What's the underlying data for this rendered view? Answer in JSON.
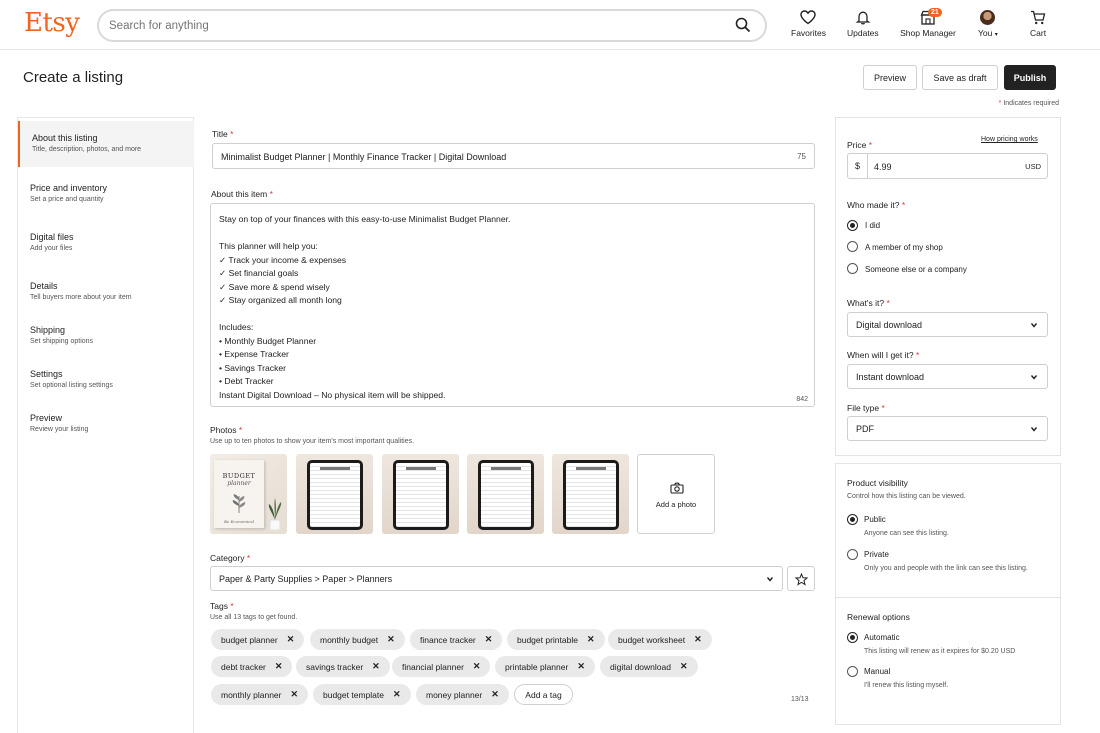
{
  "header": {
    "logo": "Etsy",
    "search_placeholder": "Search for anything",
    "nav": {
      "favorites": "Favorites",
      "updates": "Updates",
      "shop_manager": "Shop Manager",
      "shop_manager_badge": "21",
      "you": "You",
      "cart": "Cart"
    }
  },
  "page": {
    "title": "Create a listing",
    "preview_label": "Preview",
    "save_draft_label": "Save as draft",
    "publish_label": "Publish",
    "required_note": "Indicates required",
    "required_mark": "*"
  },
  "sidebar": {
    "items": [
      {
        "title": "About this listing",
        "desc": "Title, description, photos, and more"
      },
      {
        "title": "Price and inventory",
        "desc": "Set a price and quantity"
      },
      {
        "title": "Digital files",
        "desc": "Add your files"
      },
      {
        "title": "Details",
        "desc": "Tell buyers more about your item"
      },
      {
        "title": "Shipping",
        "desc": "Set shipping options"
      },
      {
        "title": "Settings",
        "desc": "Set optional listing settings"
      },
      {
        "title": "Preview",
        "desc": "Review your listing"
      }
    ]
  },
  "form": {
    "title_label": "Title",
    "title_value": "Minimalist Budget Planner | Monthly Finance Tracker | Digital Download",
    "title_count": "75",
    "about_label": "About this item",
    "about_value": "Stay on top of your finances with this easy-to-use Minimalist Budget Planner.\n\nThis planner will help you:\n✓ Track your income & expenses\n✓ Set financial goals\n✓ Save more & spend wisely\n✓ Stay organized all month long\n\nIncludes:\n• Monthly Budget Planner\n• Expense Tracker\n• Savings Tracker\n• Debt Tracker\nInstant Digital Download – No physical item will be shipped.",
    "about_count": "842",
    "photos_label": "Photos",
    "photos_help": "Use up to ten photos to show your item's most important qualities.",
    "cover_title": "BUDGET",
    "cover_subtitle": "planner",
    "cover_footer": "Be Economical",
    "add_photo_label": "Add a photo",
    "category_label": "Category",
    "category_value": "Paper & Party Supplies > Paper > Planners",
    "tags_label": "Tags",
    "tags_help": "Use all 13 tags to get found.",
    "tags": [
      "budget planner",
      "monthly budget",
      "finance tracker",
      "budget printable",
      "budget worksheet",
      "debt tracker",
      "savings tracker",
      "financial planner",
      "printable planner",
      "digital download",
      "monthly planner",
      "budget template",
      "money planner"
    ],
    "add_tag_label": "Add a tag",
    "tag_count": "13/13"
  },
  "right_panel": {
    "price_label": "Price",
    "pricing_link": "How pricing works",
    "currency_symbol": "$",
    "price_value": "4.99",
    "currency": "USD",
    "who_made_label": "Who made it?",
    "who_made_options": [
      "I did",
      "A member of my shop",
      "Someone else or a company"
    ],
    "whats_it_label": "What's it?",
    "whats_it_value": "Digital download",
    "when_label": "When will I get it?",
    "when_value": "Instant download",
    "file_type_label": "File type",
    "file_type_value": "PDF",
    "visibility_label": "Product visibility",
    "visibility_help": "Control how this listing can be viewed.",
    "public_label": "Public",
    "public_desc": "Anyone can see this listing.",
    "private_label": "Private",
    "private_desc": "Only you and people with the link can see this listing.",
    "renewal_label": "Renewal options",
    "automatic_label": "Automatic",
    "automatic_desc": "This listing will renew as it expires for $0.20 USD",
    "manual_label": "Manual",
    "manual_desc": "I'll renew this listing myself."
  },
  "colors": {
    "brand": "#f1641e",
    "dark_button": "#222222",
    "required": "#d23c3c"
  },
  "icons": [
    "search-icon",
    "heart-icon",
    "bell-icon",
    "shop-icon",
    "cart-icon",
    "camera-icon",
    "star-icon",
    "chevron-down-icon",
    "close-icon"
  ]
}
